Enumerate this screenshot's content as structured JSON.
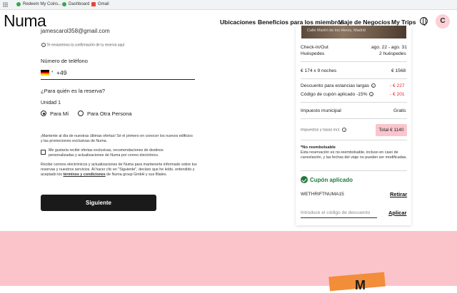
{
  "bookmarks": [
    {
      "label": "Redeem My Coins..."
    },
    {
      "label": "Dashboard"
    },
    {
      "label": "Gmail"
    }
  ],
  "header": {
    "logo": "Numa",
    "nav": [
      "Ubicaciones",
      "Beneficios para los miembros",
      "Viaje de Negocios",
      "My Trips"
    ],
    "avatar_initial": "C"
  },
  "form": {
    "email_value": "jamescarol358@gmail.com",
    "email_note": "Te enviaremos la confirmación de tu reserva aquí",
    "phone_label": "Número de teléfono",
    "phone_prefix": "+49",
    "who_title": "¿Para quién es la reserva?",
    "unit_label": "Unidad 1",
    "option_me": "Para Mí",
    "option_other": "Para Otra Persona",
    "newsletter_text": "¡Mantente al día de nuestras últimas ofertas! Sé el primero en conocer los nuevos edificios y las promociones exclusivas de Numa.",
    "checkbox_text": "Me gustaría recibir ofertas exclusivas, recomendaciones de destinos personalizadas y actualizaciones de Numa por correo electrónico.",
    "legal_text_pre": "Recibe correos electrónicos y actualizaciones de Numa para mantenerte informado sobre tus reservas y nuestros servicios. Al hacer clic en \"Siguiente\", declaro que he leído, entendido y aceptado los ",
    "legal_link": "términos y condiciones",
    "legal_text_post": " de Numa group GmbH y sus filiales.",
    "submit_label": "Siguiente"
  },
  "card": {
    "image_caption": "Calle Martín de los Heros, Madrid",
    "checkin_label": "Check-In/Out",
    "checkin_value": "ago. 22 - ago. 31",
    "guests_label": "Huéspedes",
    "guests_value": "2 huéspedes",
    "nights_label": "€ 174 x 9 noches",
    "nights_value": "€ 1568",
    "discount_label": "Descuento para estancias largas",
    "discount_value": "- € 227",
    "coupon_label": "Código de cupón aplicado -15%",
    "coupon_value": "- € 201",
    "tax_label": "Impuesto municipal",
    "tax_value": "Gratis",
    "taxes_incl_label": "Impuestos y tasas incl.",
    "total_label": "Total € 1140",
    "nonref_title": "*No reembolsable",
    "nonref_text": "Esta reservación es no-reembolsable, incluso en caso de cancelación, y las fechas del viaje no pueden ser modificadas.",
    "coupon_applied": "Cupón aplicado",
    "coupon_code": "WETHRIFTNUMA15",
    "remove_label": "Retirar",
    "code_placeholder": "Introduce el código de descuento",
    "apply_label": "Aplicar"
  },
  "footer": {
    "brand_partial": "M"
  },
  "colors": {
    "accent_pink": "#fbc4cb",
    "discount_red": "#e0242a",
    "coupon_green": "#1f7a3a",
    "button_dark": "#1a1a1a"
  }
}
